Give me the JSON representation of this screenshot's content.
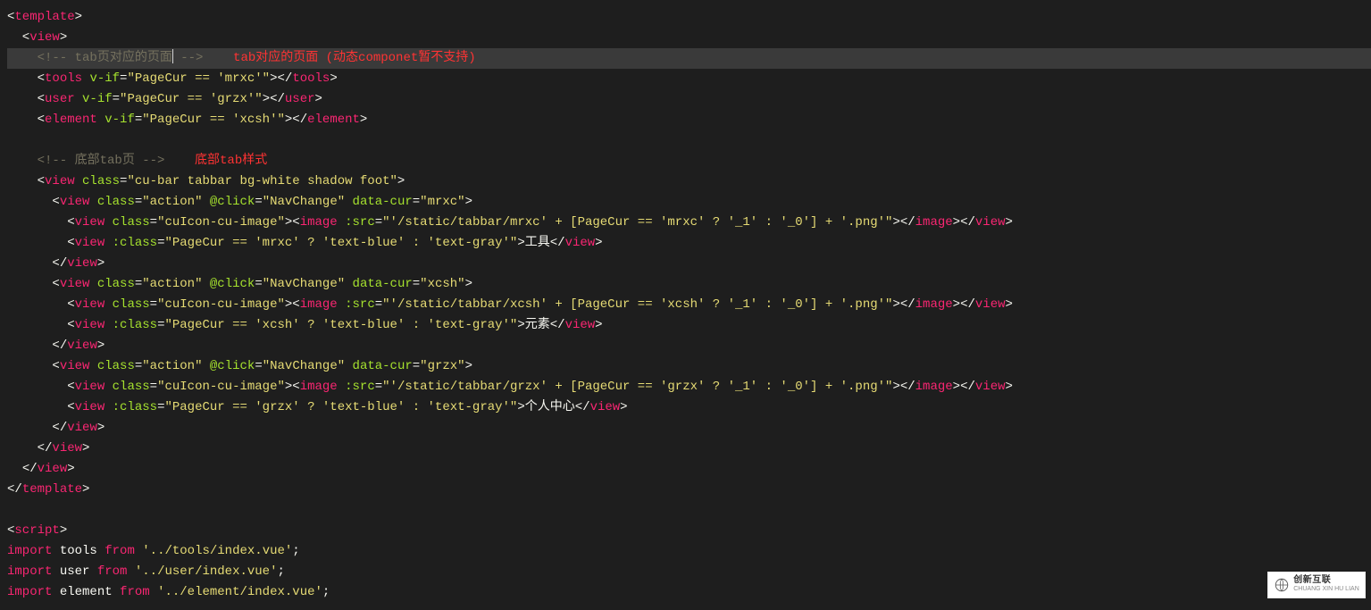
{
  "code": {
    "l1": {
      "tag_open": "<",
      "tag": "template",
      "tag_close": ">"
    },
    "l2": {
      "tag_open": "  <",
      "tag": "view",
      "tag_close": ">"
    },
    "l3": {
      "comment": "    <!-- tab页对应的页面",
      "comment_end": " -->",
      "annotation": "    tab对应的页面 (动态componet暂不支持)"
    },
    "l4": {
      "indent": "    ",
      "lt": "<",
      "tag": "tools",
      "sp": " ",
      "attr": "v-if",
      "eq": "=",
      "val": "\"PageCur == 'mrxc'\"",
      "gt": ">",
      "lt2": "</",
      "tag2": "tools",
      "gt2": ">"
    },
    "l5": {
      "indent": "    ",
      "lt": "<",
      "tag": "user",
      "sp": " ",
      "attr": "v-if",
      "eq": "=",
      "val": "\"PageCur == 'grzx'\"",
      "gt": ">",
      "lt2": "</",
      "tag2": "user",
      "gt2": ">"
    },
    "l6": {
      "indent": "    ",
      "lt": "<",
      "tag": "element",
      "sp": " ",
      "attr": "v-if",
      "eq": "=",
      "val": "\"PageCur == 'xcsh'\"",
      "gt": ">",
      "lt2": "</",
      "tag2": "element",
      "gt2": ">"
    },
    "l7": {
      "blank": " "
    },
    "l8": {
      "comment": "    <!-- 底部tab页 -->",
      "annotation": "    底部tab样式"
    },
    "l9": {
      "indent": "    ",
      "lt": "<",
      "tag": "view",
      "sp": " ",
      "attr": "class",
      "eq": "=",
      "val": "\"cu-bar tabbar bg-white shadow foot\"",
      "gt": ">"
    },
    "l10": {
      "indent": "      ",
      "lt": "<",
      "tag": "view",
      "sp": " ",
      "attr1": "class",
      "eq1": "=",
      "val1": "\"action\"",
      "sp2": " ",
      "attr2": "@click",
      "eq2": "=",
      "val2": "\"NavChange\"",
      "sp3": " ",
      "attr3": "data-cur",
      "eq3": "=",
      "val3": "\"mrxc\"",
      "gt": ">"
    },
    "l11": {
      "indent": "        ",
      "lt": "<",
      "tag": "view",
      "sp": " ",
      "attr": "class",
      "eq": "=",
      "val": "\"cuIcon-cu-image\"",
      "gt": ">",
      "lt2": "<",
      "tag2": "image",
      "sp2": " ",
      "attr2": ":src",
      "eq2": "=",
      "val2": "\"'/static/tabbar/mrxc' + [PageCur == 'mrxc' ? '_1' : '_0'] + '.png'\"",
      "gt2": ">",
      "lt3": "</",
      "tag3": "image",
      "gt3": ">",
      "lt4": "</",
      "tag4": "view",
      "gt4": ">"
    },
    "l12": {
      "indent": "        ",
      "lt": "<",
      "tag": "view",
      "sp": " ",
      "attr": ":class",
      "eq": "=",
      "val": "\"PageCur == 'mrxc' ? 'text-blue' : 'text-gray'\"",
      "gt": ">",
      "text": "工具",
      "lt2": "</",
      "tag2": "view",
      "gt2": ">"
    },
    "l13": {
      "indent": "      ",
      "lt": "</",
      "tag": "view",
      "gt": ">"
    },
    "l14": {
      "indent": "      ",
      "lt": "<",
      "tag": "view",
      "sp": " ",
      "attr1": "class",
      "eq1": "=",
      "val1": "\"action\"",
      "sp2": " ",
      "attr2": "@click",
      "eq2": "=",
      "val2": "\"NavChange\"",
      "sp3": " ",
      "attr3": "data-cur",
      "eq3": "=",
      "val3": "\"xcsh\"",
      "gt": ">"
    },
    "l15": {
      "indent": "        ",
      "lt": "<",
      "tag": "view",
      "sp": " ",
      "attr": "class",
      "eq": "=",
      "val": "\"cuIcon-cu-image\"",
      "gt": ">",
      "lt2": "<",
      "tag2": "image",
      "sp2": " ",
      "attr2": ":src",
      "eq2": "=",
      "val2": "\"'/static/tabbar/xcsh' + [PageCur == 'xcsh' ? '_1' : '_0'] + '.png'\"",
      "gt2": ">",
      "lt3": "</",
      "tag3": "image",
      "gt3": ">",
      "lt4": "</",
      "tag4": "view",
      "gt4": ">"
    },
    "l16": {
      "indent": "        ",
      "lt": "<",
      "tag": "view",
      "sp": " ",
      "attr": ":class",
      "eq": "=",
      "val": "\"PageCur == 'xcsh' ? 'text-blue' : 'text-gray'\"",
      "gt": ">",
      "text": "元素",
      "lt2": "</",
      "tag2": "view",
      "gt2": ">"
    },
    "l17": {
      "indent": "      ",
      "lt": "</",
      "tag": "view",
      "gt": ">"
    },
    "l18": {
      "indent": "      ",
      "lt": "<",
      "tag": "view",
      "sp": " ",
      "attr1": "class",
      "eq1": "=",
      "val1": "\"action\"",
      "sp2": " ",
      "attr2": "@click",
      "eq2": "=",
      "val2": "\"NavChange\"",
      "sp3": " ",
      "attr3": "data-cur",
      "eq3": "=",
      "val3": "\"grzx\"",
      "gt": ">"
    },
    "l19": {
      "indent": "        ",
      "lt": "<",
      "tag": "view",
      "sp": " ",
      "attr": "class",
      "eq": "=",
      "val": "\"cuIcon-cu-image\"",
      "gt": ">",
      "lt2": "<",
      "tag2": "image",
      "sp2": " ",
      "attr2": ":src",
      "eq2": "=",
      "val2": "\"'/static/tabbar/grzx' + [PageCur == 'grzx' ? '_1' : '_0'] + '.png'\"",
      "gt2": ">",
      "lt3": "</",
      "tag3": "image",
      "gt3": ">",
      "lt4": "</",
      "tag4": "view",
      "gt4": ">"
    },
    "l20": {
      "indent": "        ",
      "lt": "<",
      "tag": "view",
      "sp": " ",
      "attr": ":class",
      "eq": "=",
      "val": "\"PageCur == 'grzx' ? 'text-blue' : 'text-gray'\"",
      "gt": ">",
      "text": "个人中心",
      "lt2": "</",
      "tag2": "view",
      "gt2": ">"
    },
    "l21": {
      "indent": "      ",
      "lt": "</",
      "tag": "view",
      "gt": ">"
    },
    "l22": {
      "indent": "    ",
      "lt": "</",
      "tag": "view",
      "gt": ">"
    },
    "l23": {
      "indent": "  ",
      "lt": "</",
      "tag": "view",
      "gt": ">"
    },
    "l24": {
      "lt": "</",
      "tag": "template",
      "gt": ">"
    },
    "l25": {
      "blank": " "
    },
    "l26": {
      "lt": "<",
      "tag": "script",
      "gt": ">"
    },
    "l27": {
      "kw": "import",
      "sp": " ",
      "id": "tools",
      "sp2": " ",
      "kw2": "from",
      "sp3": " ",
      "str": "'../tools/index.vue'",
      "semi": ";"
    },
    "l28": {
      "kw": "import",
      "sp": " ",
      "id": "user",
      "sp2": " ",
      "kw2": "from",
      "sp3": " ",
      "str": "'../user/index.vue'",
      "semi": ";"
    },
    "l29": {
      "kw": "import",
      "sp": " ",
      "id": "element",
      "sp2": " ",
      "kw2": "from",
      "sp3": " ",
      "str": "'../element/index.vue'",
      "semi": ";"
    }
  },
  "watermark": {
    "brand": "创新互联",
    "sub": "CHUANG XIN HU LIAN"
  }
}
